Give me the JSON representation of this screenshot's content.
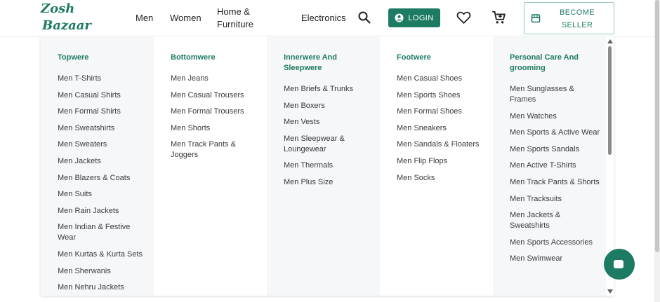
{
  "header": {
    "logo_line1": "Zosh",
    "logo_line2": "Bazaar",
    "nav": [
      "Men",
      "Women",
      "Home &",
      "Furniture",
      "Electronics"
    ],
    "login_label": "LOGIN",
    "seller_line1": "BECOME",
    "seller_line2": "SELLER",
    "icons": {
      "search": "search-icon",
      "user": "user-icon",
      "wishlist": "heart-icon",
      "cart": "cart-icon",
      "store": "store-icon"
    }
  },
  "menu": {
    "columns": [
      {
        "title": "Topwere",
        "items": [
          "Men T-Shirts",
          "Men Casual Shirts",
          "Men Formal Shirts",
          "Men Sweatshirts",
          "Men Sweaters",
          "Men Jackets",
          "Men Blazers & Coats",
          "Men Suits",
          "Men Rain Jackets",
          "Men Indian & Festive Wear",
          "Men Kurtas & Kurta Sets",
          "Men Sherwanis",
          "Men Nehru Jackets"
        ]
      },
      {
        "title": "Bottomwere",
        "items": [
          "Men Jeans",
          "Men Casual Trousers",
          "Men Formal Trousers",
          "Men Shorts",
          "Men Track Pants & Joggers"
        ]
      },
      {
        "title": "Innerwere And Sleepwere",
        "items": [
          "Men Briefs & Trunks",
          "Men Boxers",
          "Men Vests",
          "Men Sleepwear & Loungewear",
          "Men Thermals",
          "Men Plus Size"
        ]
      },
      {
        "title": "Footwere",
        "items": [
          "Men Casual Shoes",
          "Men Sports Shoes",
          "Men Formal Shoes",
          "Men Sneakers",
          "Men Sandals & Floaters",
          "Men Flip Flops",
          "Men Socks"
        ]
      },
      {
        "title": "Personal Care And grooming",
        "items": [
          "Men Sunglasses & Frames",
          "Men Watches",
          "Men Sports & Active Wear",
          "Men Sports Sandals",
          "Men Active T-Shirts",
          "Men Track Pants & Shorts",
          "Men Tracksuits",
          "Men Jackets & Sweatshirts",
          "Men Sports Accessories",
          "Men Swimwear"
        ]
      }
    ]
  },
  "colors": {
    "brand": "#1d7a63",
    "column_shade": "#f6f7f9"
  }
}
